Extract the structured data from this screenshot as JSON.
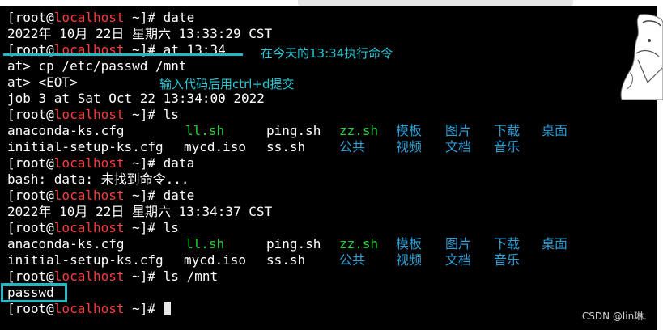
{
  "terminal": {
    "lines": {
      "l1": {
        "host": "localhost",
        "cmd": "# date"
      },
      "l2": "2022年 10月 22日 星期六 13:33:29 CST",
      "l3": {
        "host": "localhost",
        "cmd": "# at 13:34"
      },
      "l4": "at> cp /etc/passwd /mnt",
      "l5": "at> <EOT>",
      "l6": "job 3 at Sat Oct 22 13:34:00 2022",
      "l7": {
        "host": "localhost",
        "cmd": "# ls"
      },
      "l8": [
        "anaconda-ks.cfg",
        "ll.sh",
        "ping.sh",
        "zz.sh",
        "模板",
        "图片",
        "下载",
        "桌面"
      ],
      "l9": [
        "initial-setup-ks.cfg",
        "mycd.iso",
        "ss.sh",
        "公共",
        "视频",
        "文档",
        "音乐"
      ],
      "l10": {
        "host": "localhost",
        "cmd": "# data"
      },
      "l11": "bash: data: 未找到命令...",
      "l12": {
        "host": "localhost",
        "cmd": "# date"
      },
      "l13": "2022年 10月 22日 星期六 13:34:37 CST",
      "l14": {
        "host": "localhost",
        "cmd": "# ls"
      },
      "l15": [
        "anaconda-ks.cfg",
        "ll.sh",
        "ping.sh",
        "zz.sh",
        "模板",
        "图片",
        "下载",
        "桌面"
      ],
      "l16": [
        "initial-setup-ks.cfg",
        "mycd.iso",
        "ss.sh",
        "公共",
        "视频",
        "文档",
        "音乐"
      ],
      "l17": {
        "host": "localhost",
        "cmd": "# ls /mnt"
      },
      "l18": "passwd",
      "l19": {
        "host": "localhost",
        "cmd": "# "
      }
    },
    "prompt_open": "[root@",
    "prompt_mid": " ~]"
  },
  "annotations": {
    "note_schedule": "在今天的13:34执行命令",
    "note_submit": "输入代码后用ctrl+d提交"
  },
  "watermark": "CSDN @lin琳.",
  "colors": {
    "background": "#000000",
    "text": "#ffffff",
    "host": "#ff3b3b",
    "exec_file": "#22d23a",
    "directory": "#2e9fd6",
    "annotation": "#21b8c3"
  }
}
